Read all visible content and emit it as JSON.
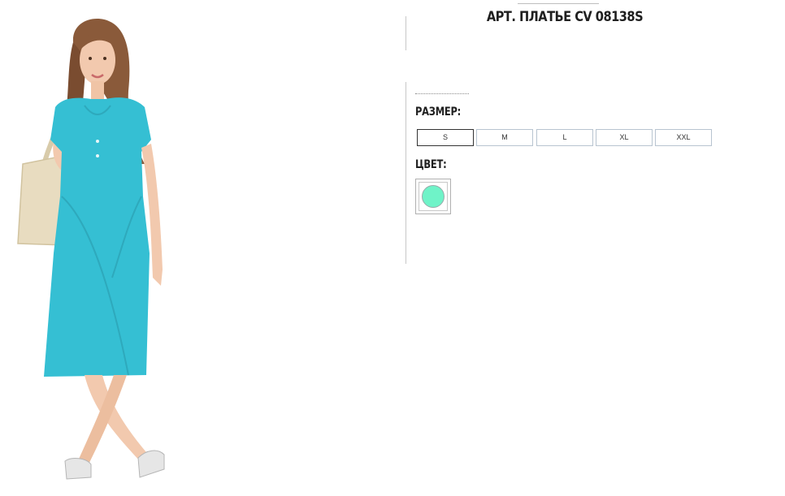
{
  "product": {
    "title": "АРТ. ПЛАТЬЕ CV 08138S"
  },
  "image": {
    "description_icon": "product-photo"
  },
  "size_section": {
    "label": "РАЗМЕР:",
    "options": [
      "S",
      "M",
      "L",
      "XL",
      "XXL"
    ],
    "selected": "S"
  },
  "color_section": {
    "label": "ЦВЕТ:",
    "swatches": [
      {
        "color": "#6ff3c8",
        "selected": true
      }
    ]
  },
  "colors": {
    "dress": "#35bfd3",
    "bag": "#e8dcc0",
    "hair": "#8a5a3a",
    "skin": "#f2c9ae",
    "text": "#1f1f1f",
    "border": "#b8c4d0"
  }
}
